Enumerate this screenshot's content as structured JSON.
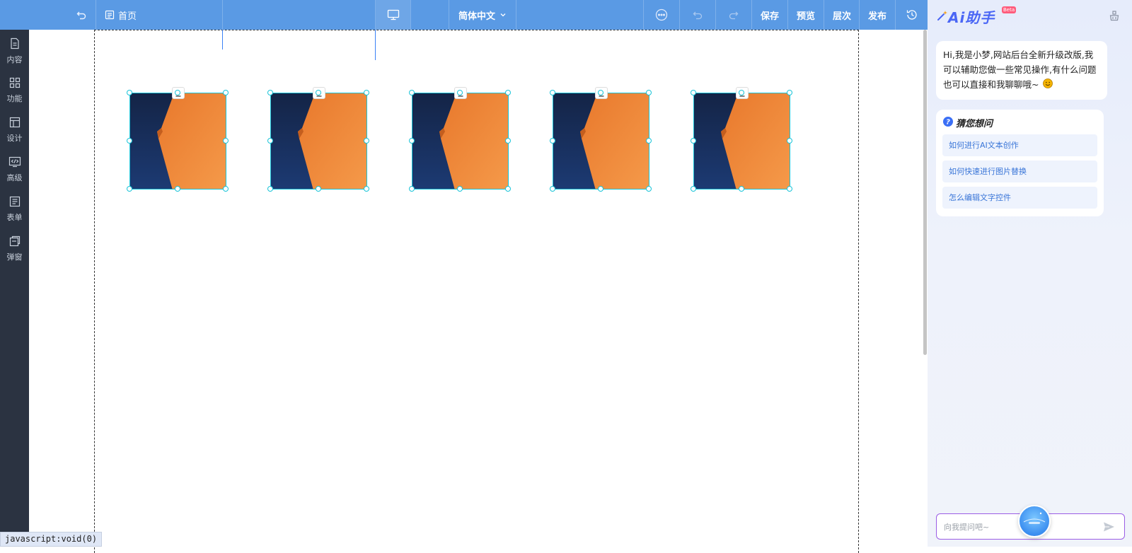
{
  "topbar": {
    "back_icon": "undo-back-icon",
    "page_icon": "page-icon",
    "page_name": "首页",
    "device_icon": "desktop-monitor-icon",
    "language": "简体中文",
    "more_icon": "more-circle-icon",
    "undo_icon": "undo-icon",
    "redo_icon": "redo-icon",
    "actions": {
      "save": "保存",
      "preview": "预览",
      "layers": "层次",
      "publish": "发布"
    },
    "history_icon": "history-clock-icon"
  },
  "sidebar": {
    "items": [
      {
        "label": "内容",
        "icon": "document-icon"
      },
      {
        "label": "功能",
        "icon": "grid-icon"
      },
      {
        "label": "设计",
        "icon": "layout-icon"
      },
      {
        "label": "高级",
        "icon": "code-icon"
      },
      {
        "label": "表单",
        "icon": "form-icon"
      },
      {
        "label": "弹窗",
        "icon": "popup-icon"
      }
    ]
  },
  "canvas": {
    "images": [
      {
        "icon": "download-icon"
      },
      {
        "icon": "download-icon"
      },
      {
        "icon": "download-icon"
      },
      {
        "icon": "download-icon"
      },
      {
        "icon": "download-icon"
      }
    ]
  },
  "status_bar": {
    "text": "javascript:void(0)"
  },
  "ai_panel": {
    "title": "Ai助手",
    "beta": "Beta",
    "clear_icon": "clear-broom-icon",
    "greeting": "Hi,我是小梦,网站后台全新升级改版,我可以辅助您做一些常见操作,有什么问题也可以直接和我聊聊哦~",
    "guess_title": "猜您想问",
    "questions": [
      "如何进行AI文本创作",
      "如何快速进行图片替换",
      "怎么编辑文字控件"
    ],
    "input_placeholder": "向我提问吧~",
    "send_icon": "send-icon"
  },
  "colors": {
    "topbar": "#5a9ae4",
    "sidebar": "#2b3341",
    "selection": "#19c4d8",
    "accent": "#4a66f5"
  }
}
